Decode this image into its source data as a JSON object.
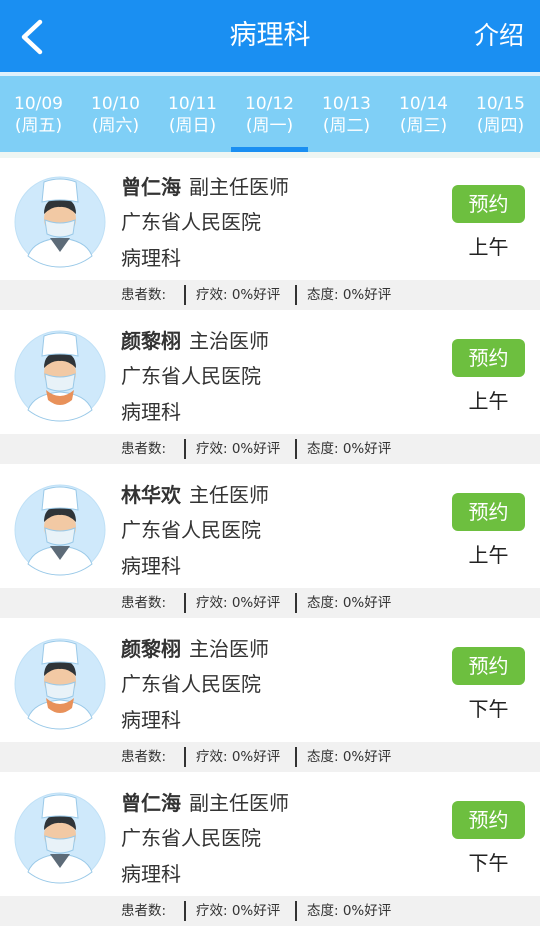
{
  "header": {
    "title": "病理科",
    "intro": "介绍"
  },
  "dates": [
    {
      "date": "10/09",
      "weekday": "(周五)"
    },
    {
      "date": "10/10",
      "weekday": "(周六)"
    },
    {
      "date": "10/11",
      "weekday": "(周日)"
    },
    {
      "date": "10/12",
      "weekday": "(周一)"
    },
    {
      "date": "10/13",
      "weekday": "(周二)"
    },
    {
      "date": "10/14",
      "weekday": "(周三)"
    },
    {
      "date": "10/15",
      "weekday": "(周四)"
    }
  ],
  "selected_date": "10/12",
  "colors": {
    "header": "#1a8ff2",
    "datebar": "#7fcff6",
    "book_button": "#6dbf3f"
  },
  "doctors": [
    {
      "name": "曾仁海",
      "title": "副主任医师",
      "hospital": "广东省人民医院",
      "dept": "病理科",
      "book": "预约",
      "slot": "上午",
      "patients": "患者数:",
      "efficacy": "疗效: 0%好评",
      "attitude": "态度: 0%好评"
    },
    {
      "name": "颜黎栩",
      "title": "主治医师",
      "hospital": "广东省人民医院",
      "dept": "病理科",
      "book": "预约",
      "slot": "上午",
      "patients": "患者数:",
      "efficacy": "疗效: 0%好评",
      "attitude": "态度: 0%好评"
    },
    {
      "name": "林华欢",
      "title": "主任医师",
      "hospital": "广东省人民医院",
      "dept": "病理科",
      "book": "预约",
      "slot": "上午",
      "patients": "患者数:",
      "efficacy": "疗效: 0%好评",
      "attitude": "态度: 0%好评"
    },
    {
      "name": "颜黎栩",
      "title": "主治医师",
      "hospital": "广东省人民医院",
      "dept": "病理科",
      "book": "预约",
      "slot": "下午",
      "patients": "患者数:",
      "efficacy": "疗效: 0%好评",
      "attitude": "态度: 0%好评"
    },
    {
      "name": "曾仁海",
      "title": "副主任医师",
      "hospital": "广东省人民医院",
      "dept": "病理科",
      "book": "预约",
      "slot": "下午",
      "patients": "患者数:",
      "efficacy": "疗效: 0%好评",
      "attitude": "态度: 0%好评"
    }
  ]
}
